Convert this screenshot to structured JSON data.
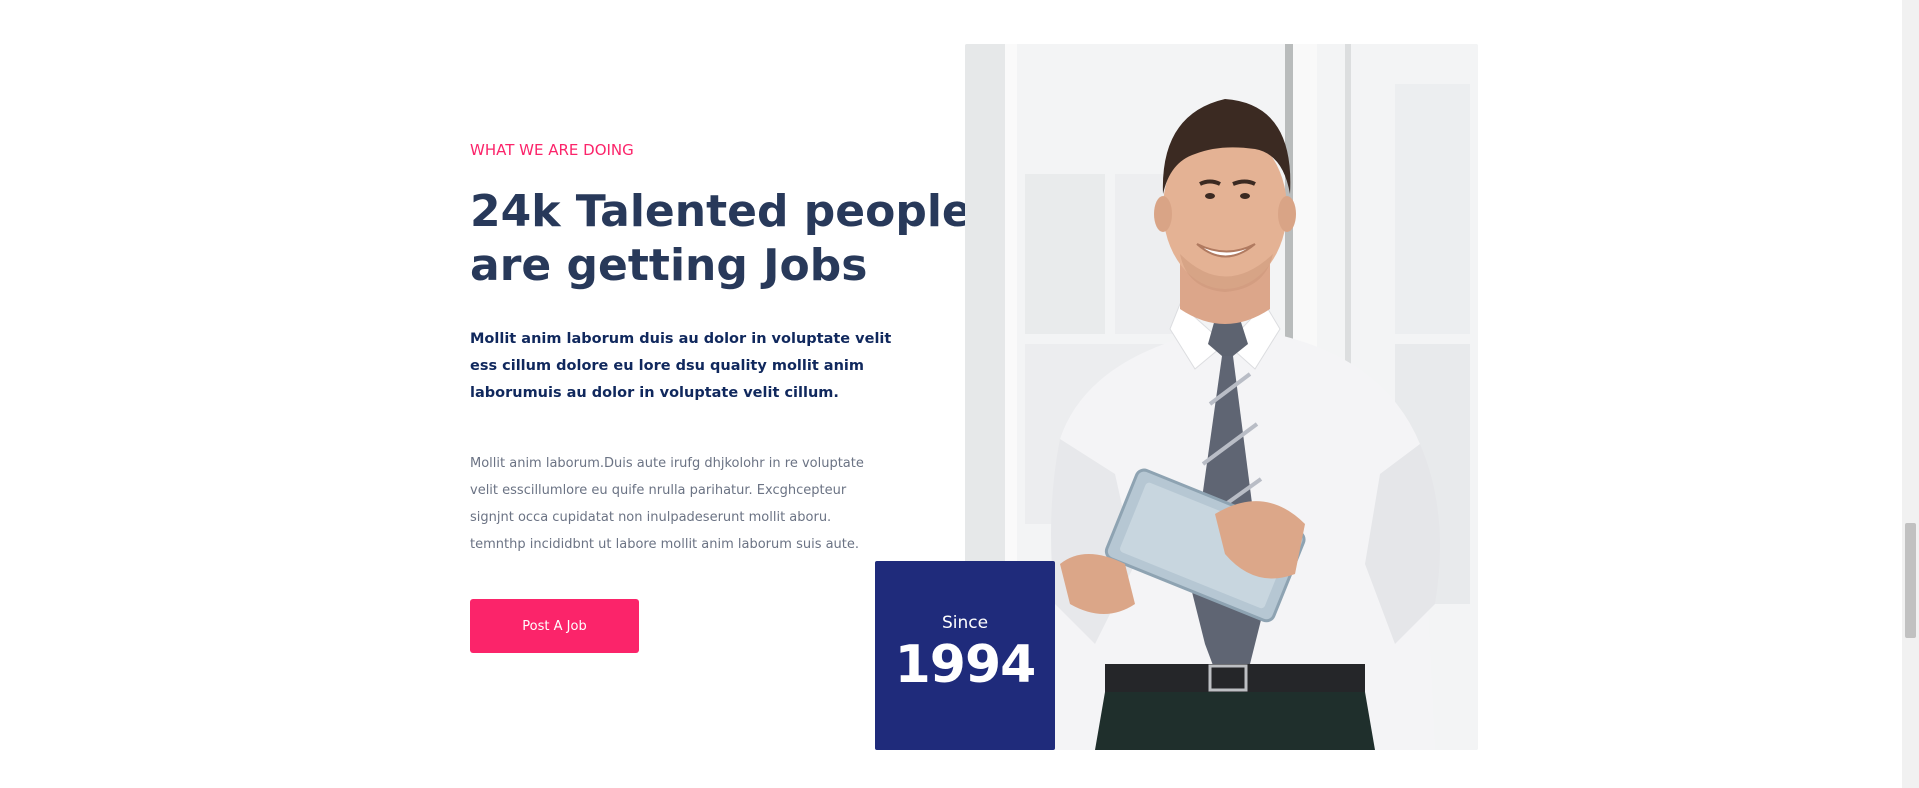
{
  "about": {
    "kicker": "WHAT WE ARE DOING",
    "headline": [
      "24k Talented people",
      "are getting Jobs"
    ],
    "lead": [
      "Mollit anim laborum duis au dolor in voluptate velit",
      "ess cillum dolore eu lore dsu quality mollit anim",
      "laborumuis au dolor in voluptate velit cillum."
    ],
    "body": [
      "Mollit anim laborum.Duis aute irufg dhjkolohr in re voluptate",
      "velit esscillumlore eu quife nrulla parihatur. Excghcepteur",
      "signjnt occa cupidatat non inulpadeserunt mollit aboru.",
      "temnthp incididbnt ut labore mollit anim laborum suis aute."
    ],
    "button_label": "Post A Job"
  },
  "since_badge": {
    "label": "Since",
    "year": "1994"
  },
  "colors": {
    "accent": "#fb246a",
    "heading": "#28395a",
    "badge_bg": "#1f2b7b"
  }
}
